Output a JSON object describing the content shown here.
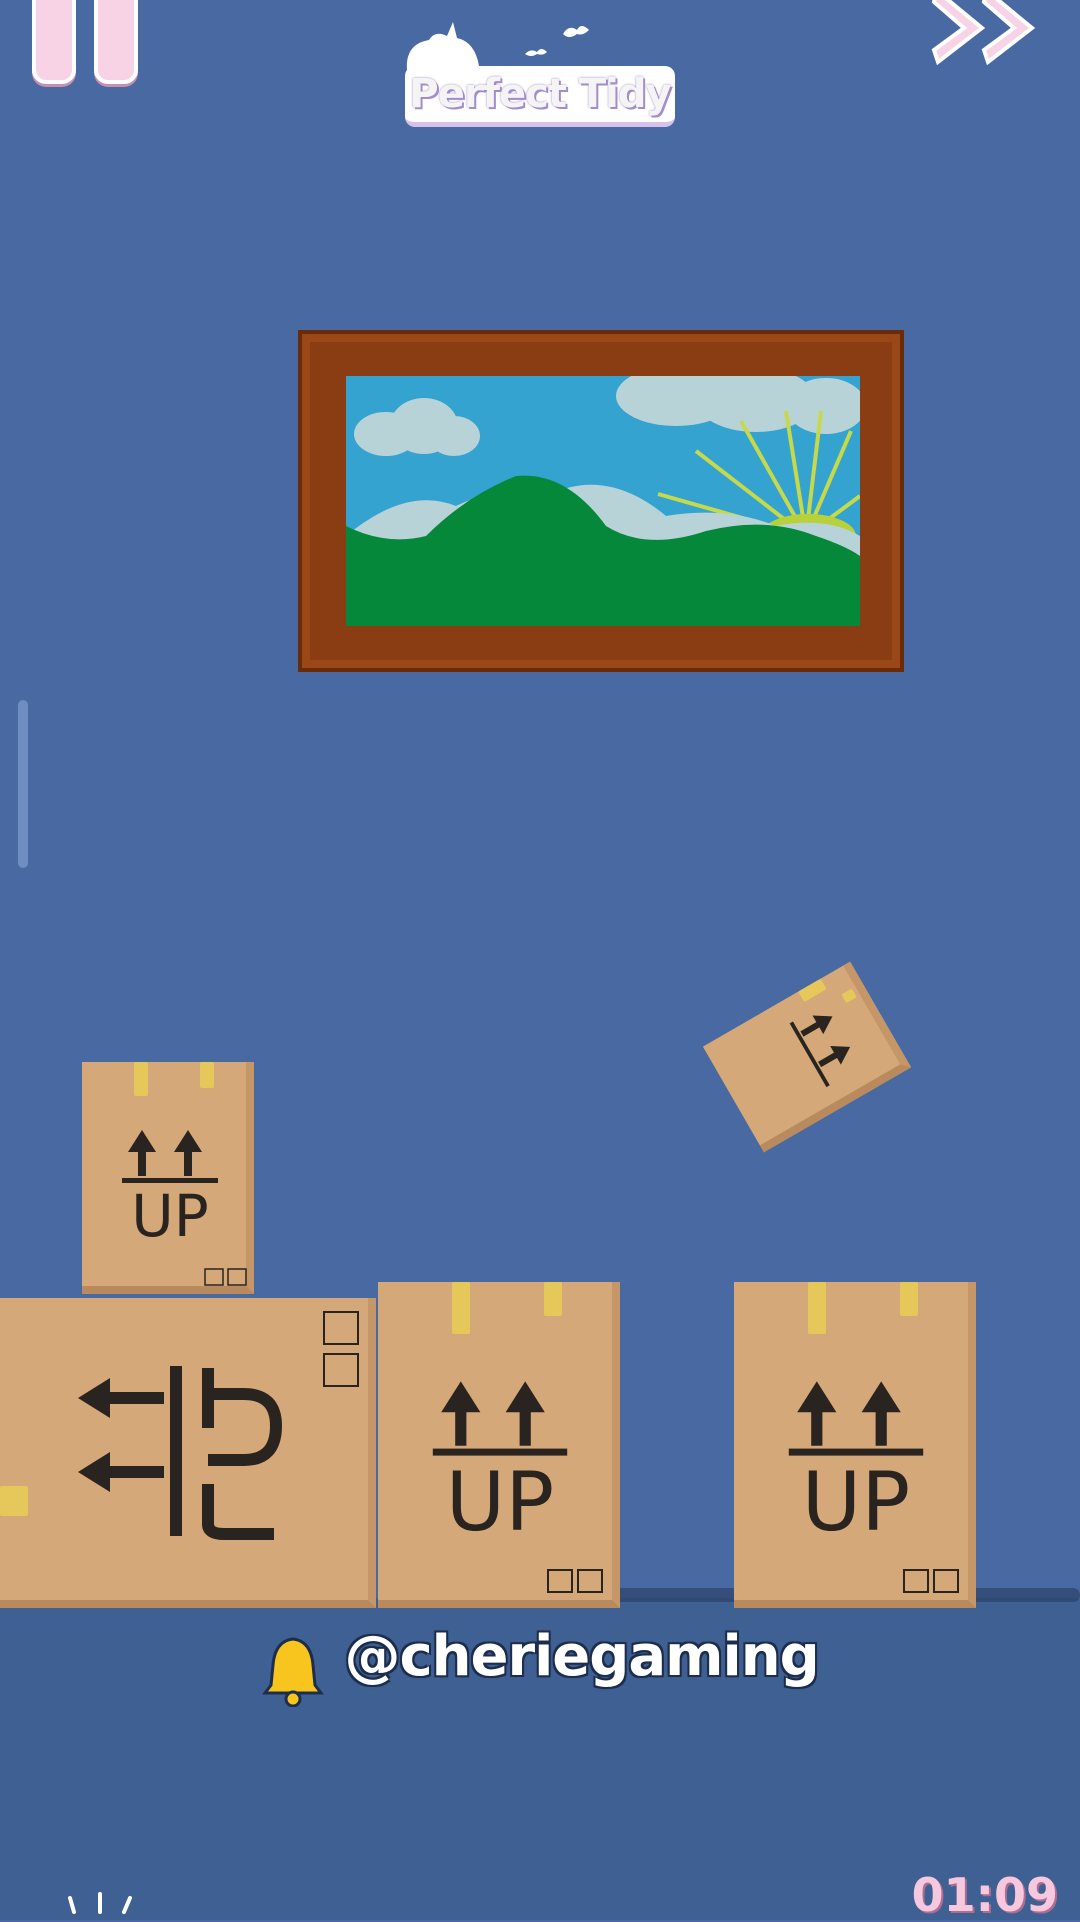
{
  "game": {
    "title": "Perfect Tidy",
    "timer": "01:09"
  },
  "hud": {
    "pause_icon": "pause-icon",
    "fast_forward_icon": "fast-forward-icon"
  },
  "painting": {
    "scene": "landscape-painting"
  },
  "boxes": {
    "label": "UP"
  },
  "overlay": {
    "handle": "@cheriegaming",
    "bell_icon": "bell-icon"
  },
  "colors": {
    "background": "#4869a1",
    "box": "#d4a878",
    "frame": "#8a3d12",
    "timer": "#f6c8dd"
  }
}
